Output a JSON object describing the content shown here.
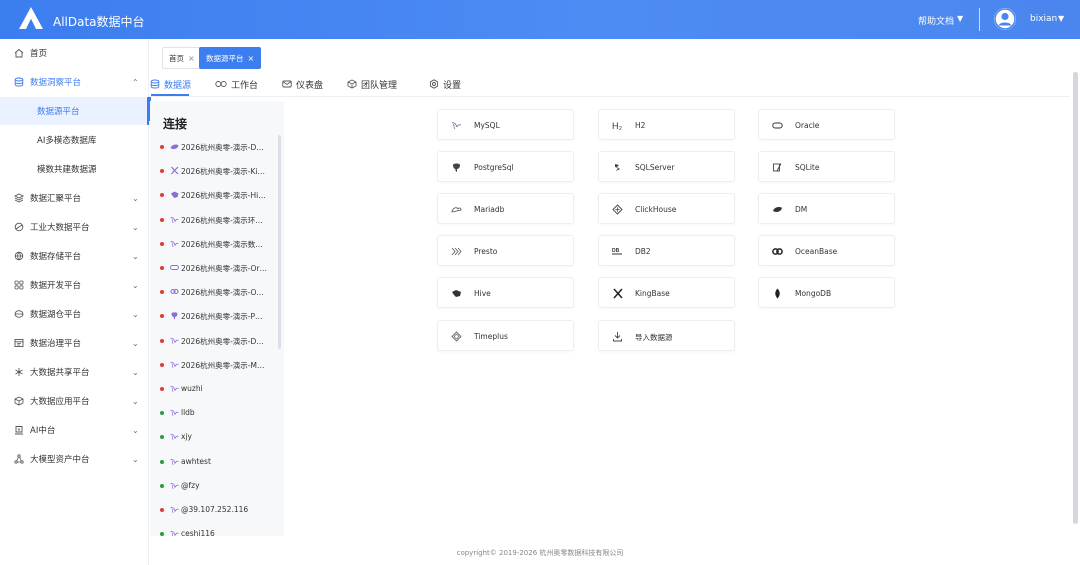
{
  "header": {
    "app_title": "AllData数据中台",
    "help_label": "帮助文档",
    "help_caret": "▼",
    "user_name": "bixian",
    "user_caret": "▼"
  },
  "sidebar": {
    "items": [
      {
        "label": "首页",
        "icon": "home-icon"
      },
      {
        "label": "数据洞察平台",
        "icon": "database-icon",
        "chevron": "⌃"
      },
      {
        "label": "数据汇聚平台",
        "icon": "layers-icon",
        "chevron": "⌄"
      },
      {
        "label": "工业大数据平台",
        "icon": "industry-icon",
        "chevron": "⌄"
      },
      {
        "label": "数据存储平台",
        "icon": "storage-icon",
        "chevron": "⌄"
      },
      {
        "label": "数据开发平台",
        "icon": "grid-icon",
        "chevron": "⌄"
      },
      {
        "label": "数据湖仓平台",
        "icon": "lake-icon",
        "chevron": "⌄"
      },
      {
        "label": "数据治理平台",
        "icon": "governance-icon",
        "chevron": "⌄"
      },
      {
        "label": "大数据共享平台",
        "icon": "share-icon",
        "chevron": "⌄"
      },
      {
        "label": "大数据应用平台",
        "icon": "cube-icon",
        "chevron": "⌄"
      },
      {
        "label": "AI中台",
        "icon": "ai-icon",
        "chevron": "⌄"
      },
      {
        "label": "大模型资产中台",
        "icon": "model-icon",
        "chevron": "⌄"
      }
    ],
    "sub_items": [
      {
        "label": "数据源平台"
      },
      {
        "label": "AI多模态数据库"
      },
      {
        "label": "模数共建数据源"
      }
    ]
  },
  "tags": [
    {
      "label": "首页",
      "close": "×"
    },
    {
      "label": "数据源平台",
      "close": "×"
    }
  ],
  "nav_tabs": [
    {
      "label": "数据源",
      "icon": "database-icon"
    },
    {
      "label": "工作台",
      "icon": "link-icon"
    },
    {
      "label": "仪表盘",
      "icon": "mail-icon"
    },
    {
      "label": "团队管理",
      "icon": "cube-icon"
    },
    {
      "label": "设置",
      "icon": "gear-icon"
    }
  ],
  "connections": {
    "title": "连接",
    "status_colors": {
      "error": "#e03b3b",
      "ok": "#2e9a3f"
    },
    "rows": [
      {
        "label": "2026杭州奥零-演示-Da...",
        "status": "error",
        "icon": "dm-icon"
      },
      {
        "label": "2026杭州奥零-演示-Kin...",
        "status": "error",
        "icon": "kingbase-icon"
      },
      {
        "label": "2026杭州奥零-演示-Hiv...",
        "status": "error",
        "icon": "hive-icon"
      },
      {
        "label": "2026杭州奥零-演示环境...",
        "status": "error",
        "icon": "mysql-icon"
      },
      {
        "label": "2026杭州奥零-演示数仓...",
        "status": "error",
        "icon": "mysql-icon"
      },
      {
        "label": "2026杭州奥零-演示-Ora...",
        "status": "error",
        "icon": "oracle-icon"
      },
      {
        "label": "2026杭州奥零-演示-Oc...",
        "status": "error",
        "icon": "oceanbase-icon"
      },
      {
        "label": "2026杭州奥零-演示-PG...",
        "status": "error",
        "icon": "postgres-icon"
      },
      {
        "label": "2026杭州奥零-演示-Dor...",
        "status": "error",
        "icon": "mysql-icon"
      },
      {
        "label": "2026杭州奥零-演示-My...",
        "status": "error",
        "icon": "mysql-icon"
      },
      {
        "label": "wuzhi",
        "status": "error",
        "icon": "mysql-icon"
      },
      {
        "label": "lldb",
        "status": "ok",
        "icon": "mysql-icon"
      },
      {
        "label": "xjy",
        "status": "ok",
        "icon": "mysql-icon"
      },
      {
        "label": "awhtest",
        "status": "ok",
        "icon": "mysql-icon"
      },
      {
        "label": "@fzy",
        "status": "ok",
        "icon": "mysql-icon"
      },
      {
        "label": "@39.107.252.116",
        "status": "error",
        "icon": "mysql-icon"
      },
      {
        "label": "ceshi116",
        "status": "ok",
        "icon": "mysql-icon"
      }
    ]
  },
  "datasources": [
    {
      "label": "MySQL",
      "icon": "mysql-icon"
    },
    {
      "label": "H2",
      "icon": "h2-icon"
    },
    {
      "label": "Oracle",
      "icon": "oracle-icon"
    },
    {
      "label": "PostgreSql",
      "icon": "postgres-icon"
    },
    {
      "label": "SQLServer",
      "icon": "sqlserver-icon"
    },
    {
      "label": "SQLite",
      "icon": "sqlite-icon"
    },
    {
      "label": "Mariadb",
      "icon": "mariadb-icon"
    },
    {
      "label": "ClickHouse",
      "icon": "clickhouse-icon"
    },
    {
      "label": "DM",
      "icon": "dm-icon"
    },
    {
      "label": "Presto",
      "icon": "presto-icon"
    },
    {
      "label": "DB2",
      "icon": "db2-icon"
    },
    {
      "label": "OceanBase",
      "icon": "oceanbase-icon"
    },
    {
      "label": "Hive",
      "icon": "hive-icon"
    },
    {
      "label": "KingBase",
      "icon": "kingbase-icon"
    },
    {
      "label": "MongoDB",
      "icon": "mongodb-icon"
    },
    {
      "label": "Timeplus",
      "icon": "timeplus-icon"
    },
    {
      "label": "导入数据源",
      "icon": "import-icon"
    }
  ],
  "footer": "copyright© 2019-2026 杭州奥零数据科技有限公司",
  "colors": {
    "accent": "#3c7df0",
    "header_bg": "#4a86ee"
  }
}
